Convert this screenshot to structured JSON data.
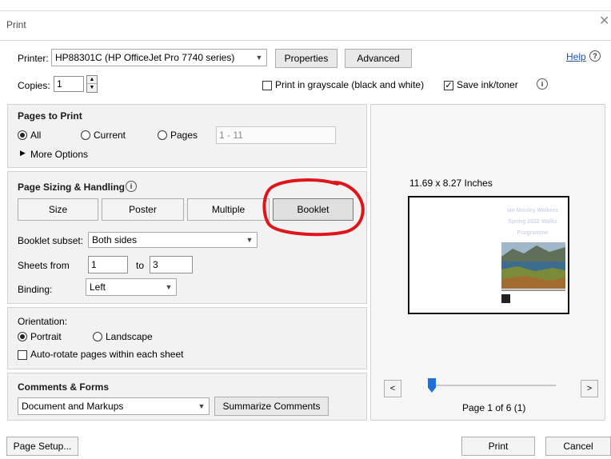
{
  "window": {
    "title": "Print",
    "close_glyph": "✕"
  },
  "printer": {
    "label": "Printer:",
    "value": "HP88301C (HP OfficeJet Pro 7740 series)",
    "properties_label": "Properties",
    "advanced_label": "Advanced",
    "help_label": "Help"
  },
  "copies": {
    "label": "Copies:",
    "value": "1"
  },
  "options": {
    "grayscale_label": "Print in grayscale (black and white)",
    "grayscale_checked": false,
    "save_ink_label": "Save ink/toner",
    "save_ink_checked": true
  },
  "pages_to_print": {
    "heading": "Pages to Print",
    "all_label": "All",
    "current_label": "Current",
    "pages_label": "Pages",
    "pages_range_value": "1 - 11",
    "more_options_label": "More Options",
    "selected": "All"
  },
  "sizing": {
    "heading": "Page Sizing & Handling",
    "buttons": [
      "Size",
      "Poster",
      "Multiple",
      "Booklet"
    ],
    "selected": "Booklet",
    "booklet_subset_label": "Booklet subset:",
    "booklet_subset_value": "Both sides",
    "sheets_from_label": "Sheets from",
    "sheets_from_value": "1",
    "to_label": "to",
    "sheets_to_value": "3",
    "binding_label": "Binding:",
    "binding_value": "Left"
  },
  "orientation": {
    "heading": "Orientation:",
    "portrait_label": "Portrait",
    "landscape_label": "Landscape",
    "selected": "Portrait",
    "auto_rotate_label": "Auto-rotate pages within each sheet",
    "auto_rotate_checked": false
  },
  "comments": {
    "heading": "Comments & Forms",
    "value": "Document and Markups",
    "summarize_label": "Summarize Comments"
  },
  "preview": {
    "size_label": "11.69 x 8.27 Inches",
    "page_text": [
      "Ian Mosley Walkers",
      "Spring 2022 Walks",
      "Programme"
    ],
    "page_indicator": "Page 1 of 6 (1)",
    "prev_label": "<",
    "next_label": ">",
    "slider_position": 0.0
  },
  "footer": {
    "page_setup_label": "Page Setup...",
    "print_label": "Print",
    "cancel_label": "Cancel"
  },
  "colors": {
    "annotation_red": "#e0151b",
    "link_blue": "#1a4fb8",
    "slider_blue": "#1e6fd9"
  }
}
